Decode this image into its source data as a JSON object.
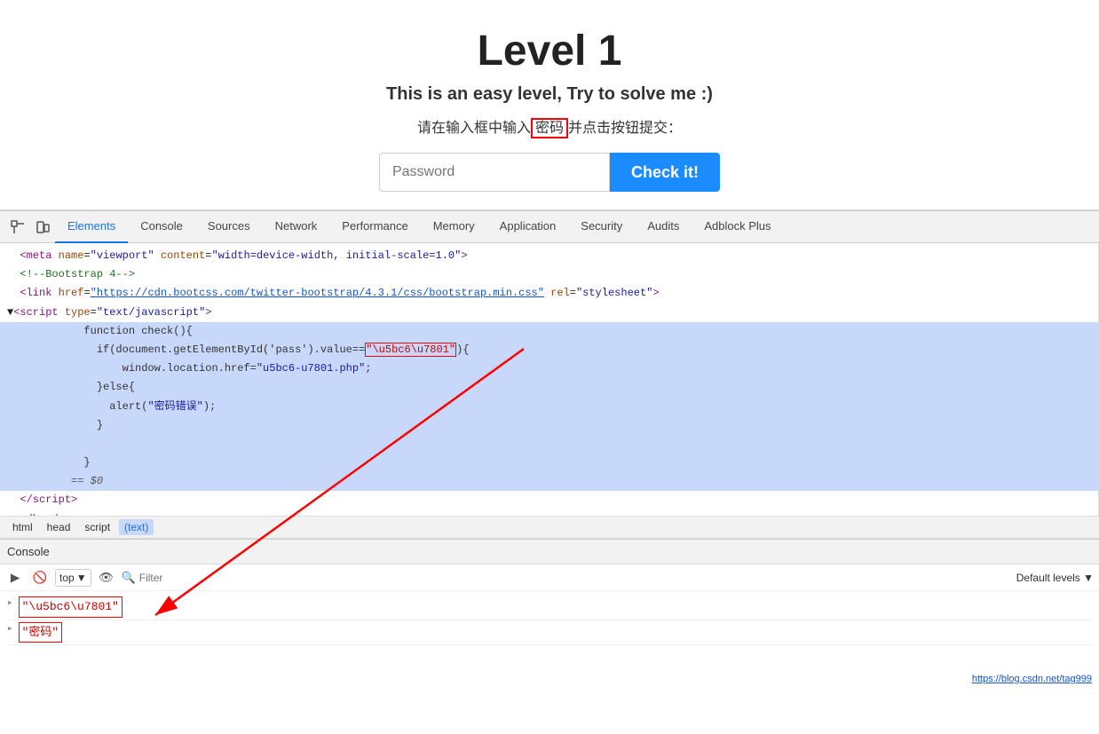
{
  "page": {
    "title": "Level 1",
    "subtitle": "This is an easy level, Try to solve me :)",
    "instruction_before": "请在输入框中输入",
    "instruction_highlight": "密码",
    "instruction_after": "并点击按钮提交：",
    "password_placeholder": "Password",
    "check_button": "Check it!"
  },
  "devtools": {
    "tabs": [
      {
        "label": "Elements",
        "active": true
      },
      {
        "label": "Console",
        "active": false
      },
      {
        "label": "Sources",
        "active": false
      },
      {
        "label": "Network",
        "active": false
      },
      {
        "label": "Performance",
        "active": false
      },
      {
        "label": "Memory",
        "active": false
      },
      {
        "label": "Application",
        "active": false
      },
      {
        "label": "Security",
        "active": false
      },
      {
        "label": "Audits",
        "active": false
      },
      {
        "label": "Adblock Plus",
        "active": false
      }
    ],
    "breadcrumb": [
      "html",
      "head",
      "script",
      "(text)"
    ],
    "console": {
      "header": "Console",
      "top_label": "top",
      "filter_placeholder": "Filter",
      "levels_label": "Default levels ▼",
      "output": [
        {
          "arrow": "▸",
          "value": "\"\\u5bc6\\u7801\"",
          "highlight": true
        },
        {
          "arrow": "▸",
          "value": "\"密码\"",
          "highlight": true
        }
      ]
    }
  },
  "watermark": "https://blog.csdn.net/tag999"
}
